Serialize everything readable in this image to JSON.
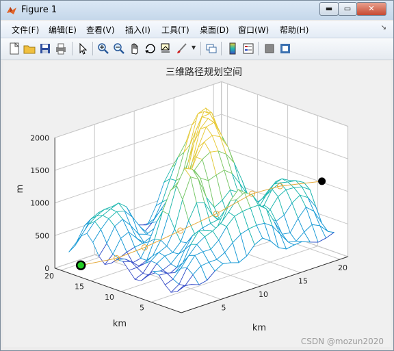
{
  "window": {
    "title": "Figure 1",
    "controls": {
      "minimize": "▬",
      "maximize": "▭",
      "close": "✕"
    }
  },
  "menubar": {
    "items": [
      {
        "label": "文件(F)"
      },
      {
        "label": "编辑(E)"
      },
      {
        "label": "查看(V)"
      },
      {
        "label": "插入(I)"
      },
      {
        "label": "工具(T)"
      },
      {
        "label": "桌面(D)"
      },
      {
        "label": "窗口(W)"
      },
      {
        "label": "帮助(H)"
      }
    ],
    "overflow": "↘"
  },
  "toolbar": {
    "buttons": [
      {
        "icon": "new-figure-icon"
      },
      {
        "icon": "open-folder-icon"
      },
      {
        "icon": "save-icon"
      },
      {
        "icon": "print-icon"
      },
      {
        "icon": "pointer-icon"
      },
      {
        "icon": "zoom-in-icon"
      },
      {
        "icon": "zoom-out-icon"
      },
      {
        "icon": "pan-hand-icon"
      },
      {
        "icon": "rotate-3d-icon"
      },
      {
        "icon": "data-cursor-icon"
      },
      {
        "icon": "brush-icon"
      },
      {
        "icon": "link-plot-icon"
      },
      {
        "icon": "colorbar-icon"
      },
      {
        "icon": "legend-icon"
      },
      {
        "icon": "hide-plot-tools-icon"
      },
      {
        "icon": "show-plot-tools-icon"
      }
    ]
  },
  "chart_data": {
    "type": "surface",
    "title": "三维路径规划空间",
    "xlabel": "km",
    "ylabel": "km",
    "zlabel": "m",
    "xlim": [
      0,
      21
    ],
    "ylim": [
      0,
      21
    ],
    "zlim": [
      0,
      2000
    ],
    "xticks": [
      "5",
      "10",
      "15",
      "20"
    ],
    "yticks": [
      "5",
      "10",
      "15",
      "20"
    ],
    "zticks": [
      "0",
      "500",
      "1000",
      "1500",
      "2000"
    ],
    "grid": true,
    "colormap": [
      "#3a4fc9",
      "#1b9bd6",
      "#20b8b0",
      "#7ac86a",
      "#e8cb3c"
    ],
    "start_point": {
      "x": 1,
      "y": 18,
      "z": 100,
      "color": "#22cc22"
    },
    "goal_point": {
      "x": 20,
      "y": 3,
      "z": 1100,
      "color": "#000000"
    },
    "path_color": "#e5a93a",
    "path": [
      {
        "x": 1,
        "y": 18,
        "z": 100
      },
      {
        "x": 4,
        "y": 16,
        "z": 150
      },
      {
        "x": 6,
        "y": 14,
        "z": 300
      },
      {
        "x": 9,
        "y": 12,
        "z": 500
      },
      {
        "x": 12,
        "y": 10,
        "z": 700
      },
      {
        "x": 15,
        "y": 8,
        "z": 950
      },
      {
        "x": 17,
        "y": 6,
        "z": 1050
      },
      {
        "x": 20,
        "y": 3,
        "z": 1100
      }
    ]
  },
  "watermark": "CSDN @mozun2020"
}
